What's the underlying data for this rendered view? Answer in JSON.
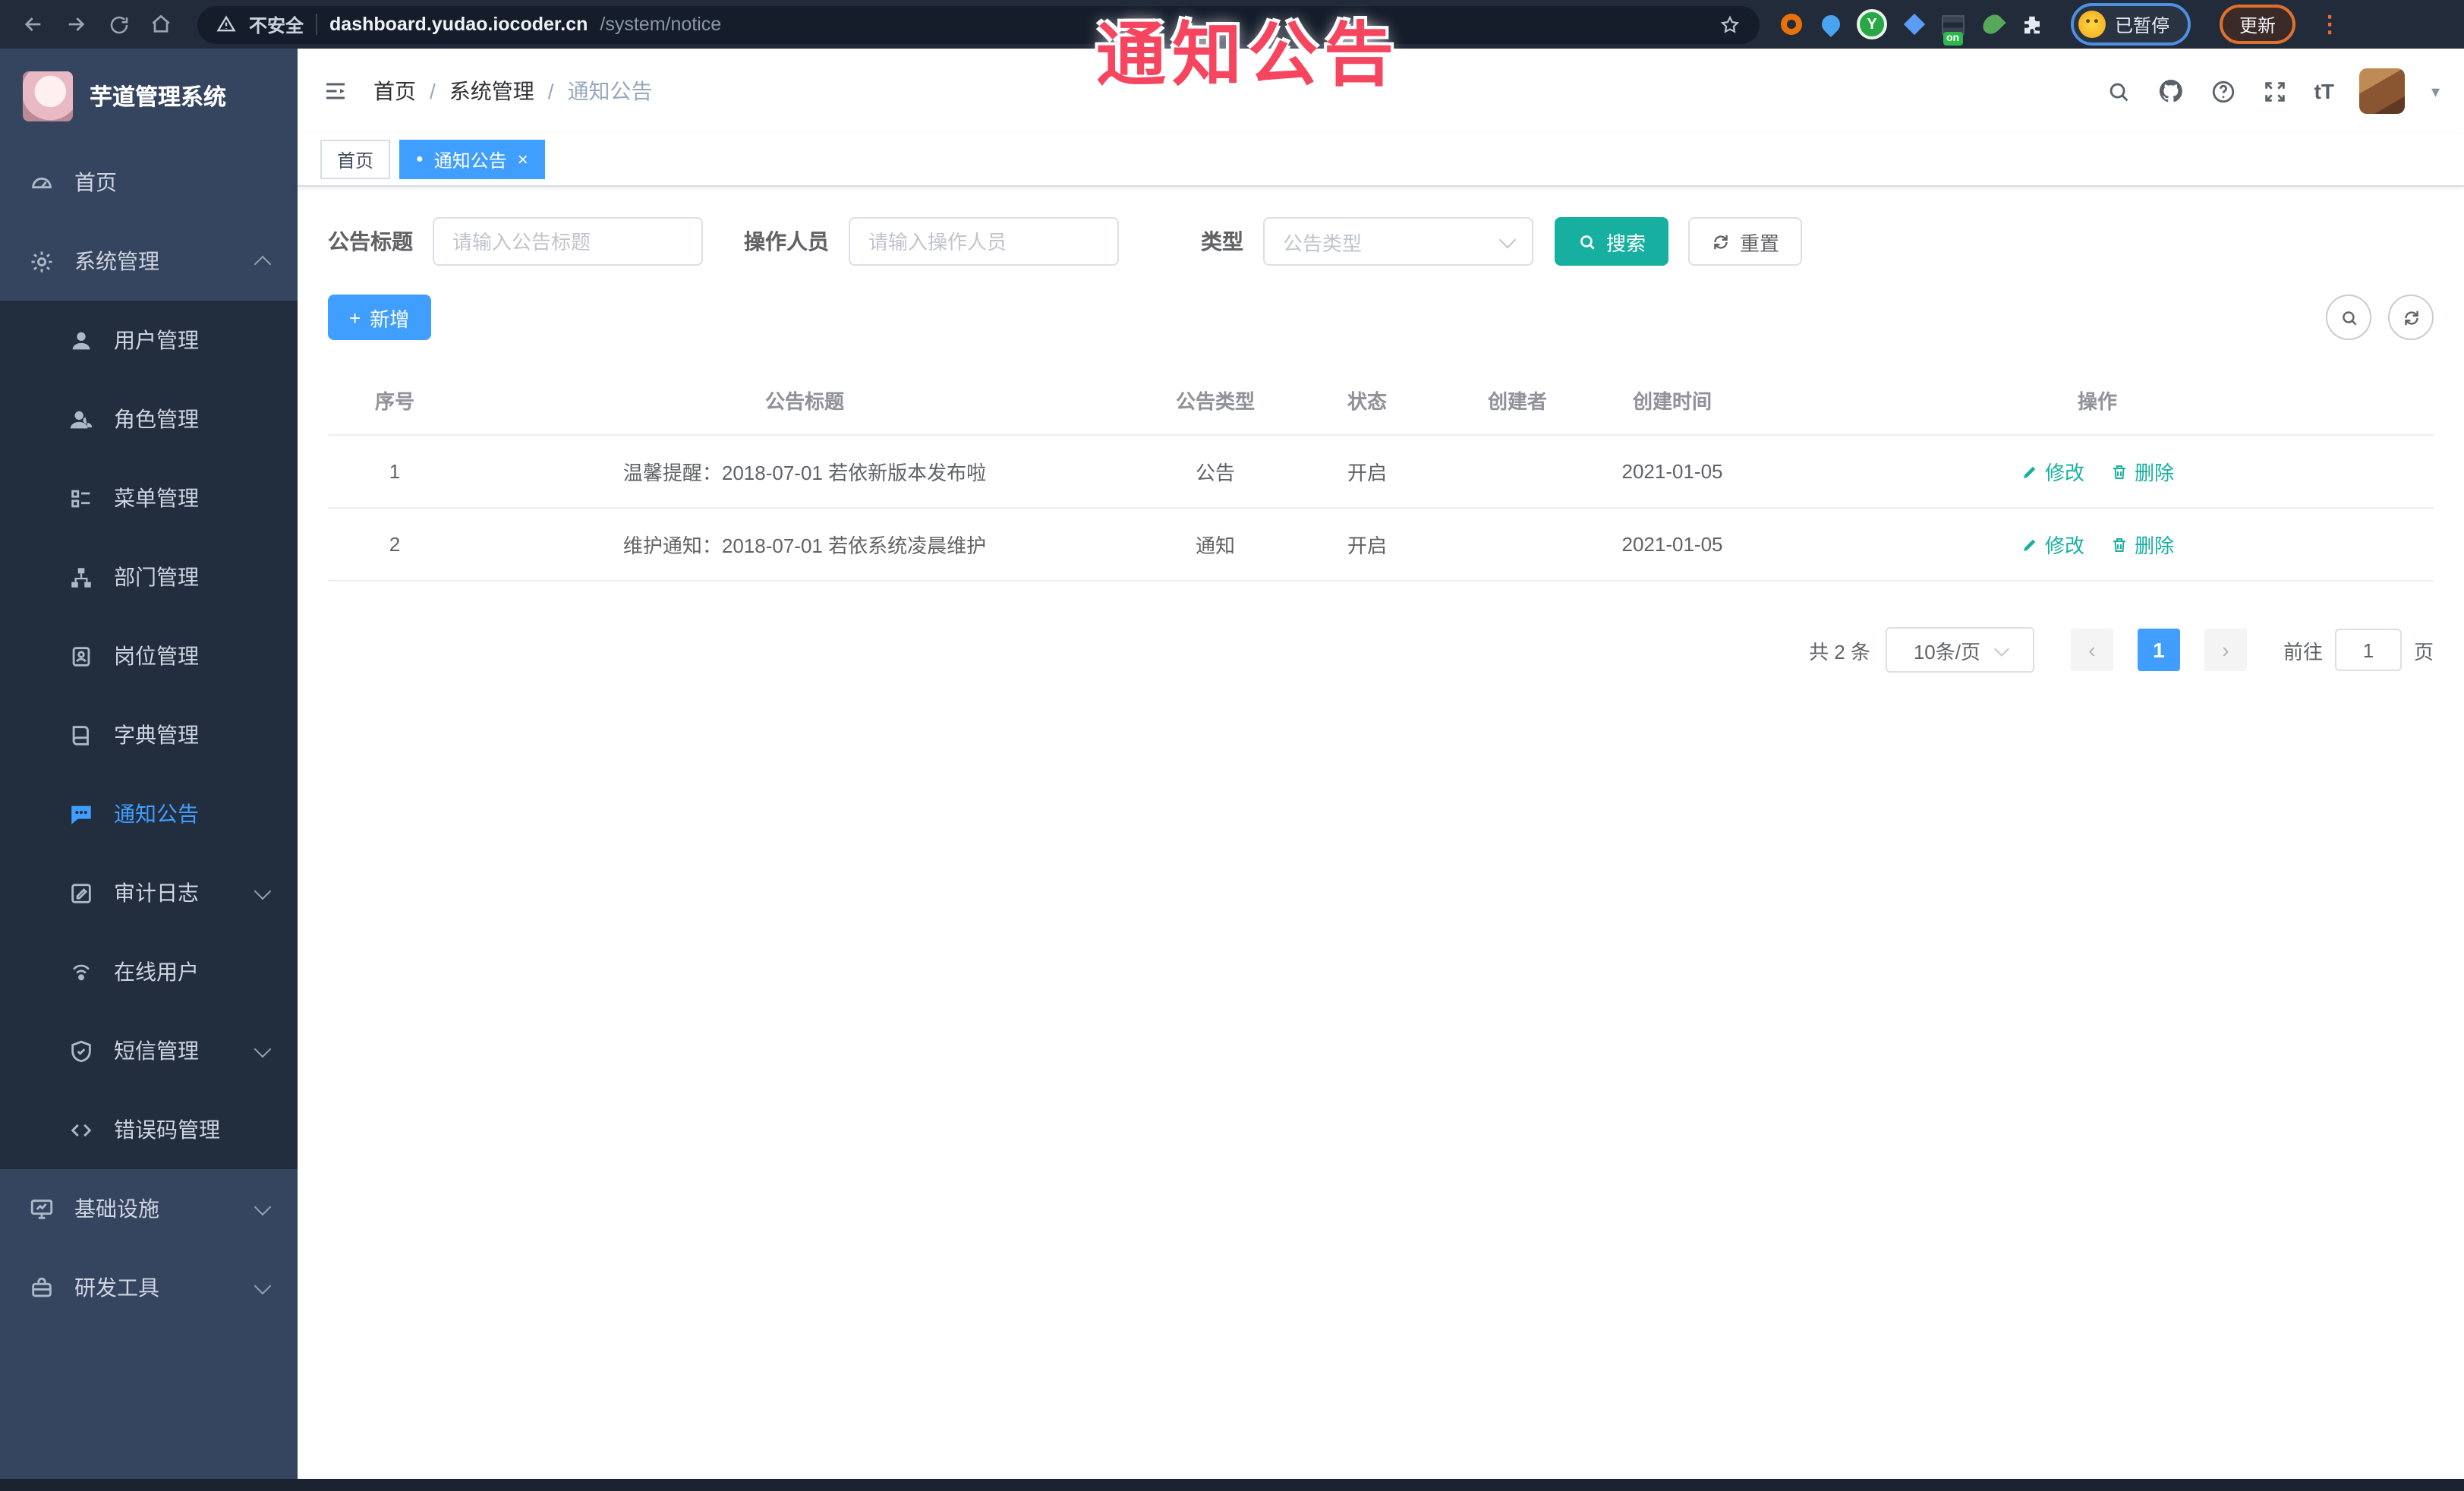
{
  "browser": {
    "security_label": "不安全",
    "url_host": "dashboard.yudao.iocoder.cn",
    "url_path": "/system/notice",
    "extension_badge": "on",
    "extension_letter": "Y",
    "paused_label": "已暂停",
    "update_label": "更新"
  },
  "annotation": {
    "text": "通知公告"
  },
  "icons": {
    "dot": "●",
    "close": "×",
    "caret_down": "▾",
    "kebab": "⋮",
    "plus": "+",
    "font_size": "tT",
    "prev": "‹",
    "next": "›"
  },
  "sidebar": {
    "title": "芋道管理系统",
    "home": "首页",
    "system": "系统管理",
    "submenu": [
      "用户管理",
      "角色管理",
      "菜单管理",
      "部门管理",
      "岗位管理",
      "字典管理",
      "通知公告",
      "审计日志",
      "在线用户",
      "短信管理",
      "错误码管理"
    ],
    "infra": "基础设施",
    "devtools": "研发工具"
  },
  "header": {
    "breadcrumb": [
      "首页",
      "系统管理",
      "通知公告"
    ],
    "separator": "/"
  },
  "tabs": [
    {
      "label": "首页"
    },
    {
      "label": "通知公告"
    }
  ],
  "filters": {
    "title_label": "公告标题",
    "title_placeholder": "请输入公告标题",
    "operator_label": "操作人员",
    "operator_placeholder": "请输入操作人员",
    "type_label": "类型",
    "type_placeholder": "公告类型",
    "search_label": "搜索",
    "reset_label": "重置"
  },
  "toolbar": {
    "add_label": "新增"
  },
  "table": {
    "columns": [
      "序号",
      "公告标题",
      "公告类型",
      "状态",
      "创建者",
      "创建时间",
      "操作"
    ],
    "edit_label": "修改",
    "delete_label": "删除",
    "rows": [
      {
        "no": "1",
        "title": "温馨提醒：2018-07-01 若依新版本发布啦",
        "type": "公告",
        "status": "开启",
        "creator": "",
        "create_time": "2021-01-05"
      },
      {
        "no": "2",
        "title": "维护通知：2018-07-01 若依系统凌晨维护",
        "type": "通知",
        "status": "开启",
        "creator": "",
        "create_time": "2021-01-05"
      }
    ]
  },
  "pagination": {
    "total": "共 2 条",
    "page_size": "10条/页",
    "current": "1",
    "goto_label": "前往",
    "goto_value": "1",
    "unit": "页"
  },
  "colors": {
    "primary": "#409eff",
    "teal": "#17b0a0",
    "annotation": "#f5455f",
    "sidebar_bg": "#36455f",
    "submenu_bg": "#222d3d"
  }
}
